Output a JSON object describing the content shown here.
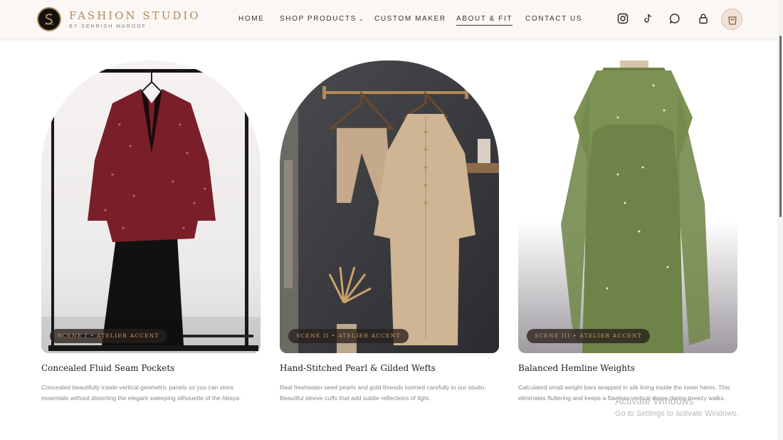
{
  "brand": {
    "name": "FASHION STUDIO",
    "subtitle": "BY SEHRISH MAROOF",
    "logo_icon": "brand-monogram-icon",
    "accent": "#b08a5a"
  },
  "nav": {
    "items": [
      {
        "label": "HOME"
      },
      {
        "label": "SHOP PRODUCTS",
        "has_dropdown": true
      },
      {
        "label": "CUSTOM MAKER"
      },
      {
        "label": "ABOUT & FIT",
        "active": true
      },
      {
        "label": "CONTACT US"
      }
    ],
    "icons": [
      "instagram-icon",
      "tiktok-icon",
      "chat-icon",
      "lock-icon",
      "cart-icon"
    ]
  },
  "cards": [
    {
      "scene": "SCENE I • ATELIER ACCENT",
      "title": "Concealed Fluid Seam Pockets",
      "desc": "Concealed beautifully inside vertical geometric panels so you can store essentials without distorting the elegant sweeping silhouette of the Abaya.",
      "image": "maroon floral blazer over black abaya on hanger rack"
    },
    {
      "scene": "SCENE II • ATELIER ACCENT",
      "title": "Hand-Stitched Pearl & Gilded Wefts",
      "desc": "Real freshwater seed pearls and gold threads loomed carefully in our studio. Beautiful sleeve cuffs that add subtle reflections of light.",
      "image": "beige trousers and long tunic on wooden hangers"
    },
    {
      "scene": "SCENE III • ATELIER ACCENT",
      "title": "Balanced Hemline Weights",
      "desc": "Calculated small weight bars wrapped in silk lining inside the lower hems. This eliminates fluttering and keeps a flawless vertical drape during breezy walks.",
      "image": "olive green cape gown with embellishments on mannequin"
    }
  ],
  "watermark": {
    "title": "Activate Windows",
    "subtitle": "Go to Settings to activate Windows."
  }
}
